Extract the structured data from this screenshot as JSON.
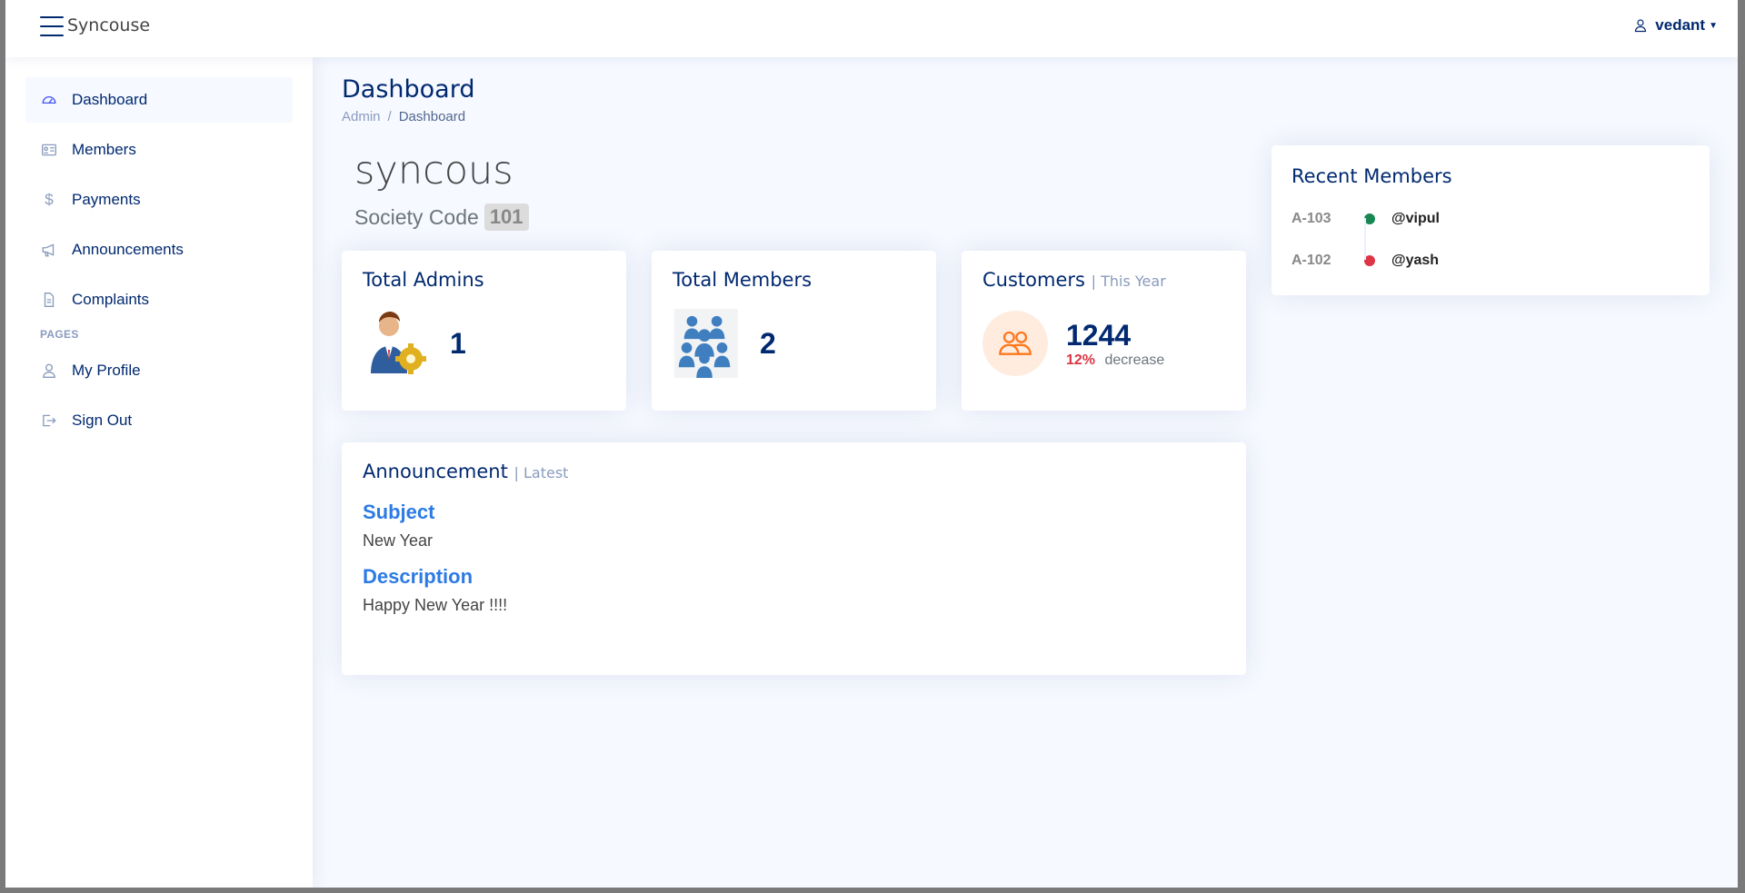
{
  "app": {
    "brand": "Syncouse"
  },
  "header": {
    "user_name": "vedant"
  },
  "sidebar": {
    "items": [
      {
        "label": "Dashboard",
        "icon": "speedometer-icon"
      },
      {
        "label": "Members",
        "icon": "id-card-icon"
      },
      {
        "label": "Payments",
        "icon": "dollar-icon"
      },
      {
        "label": "Announcements",
        "icon": "megaphone-icon"
      },
      {
        "label": "Complaints",
        "icon": "document-icon"
      }
    ],
    "pages_heading": "PAGES",
    "pages": [
      {
        "label": "My Profile",
        "icon": "person-icon"
      },
      {
        "label": "Sign Out",
        "icon": "sign-out-icon"
      }
    ]
  },
  "main": {
    "title": "Dashboard",
    "breadcrumb": [
      "Admin",
      "/",
      "Dashboard"
    ],
    "society_name": "syncous",
    "society_code_label": "Society Code",
    "society_code": "101"
  },
  "cards": {
    "admins": {
      "title": "Total Admins",
      "value": "1"
    },
    "members": {
      "title": "Total Members",
      "value": "2"
    },
    "customers": {
      "title": "Customers",
      "subtitle": "| This Year",
      "value": "1244",
      "change": "12%",
      "direction": "decrease"
    }
  },
  "announcement": {
    "title": "Announcement",
    "subtitle": "| Latest",
    "subject_label": "Subject",
    "subject": "New Year",
    "description_label": "Description",
    "description": "Happy New Year !!!!"
  },
  "recent_members": {
    "title": "Recent Members",
    "items": [
      {
        "code": "A-103",
        "user": "@vipul",
        "status_color": "#198754"
      },
      {
        "code": "A-102",
        "user": "@yash",
        "status_color": "#dc3545"
      }
    ]
  },
  "colors": {
    "primary": "#012970",
    "accent_blue": "#2c7be5",
    "orange": "#ff771d",
    "danger": "#dc3545",
    "success": "#198754"
  }
}
